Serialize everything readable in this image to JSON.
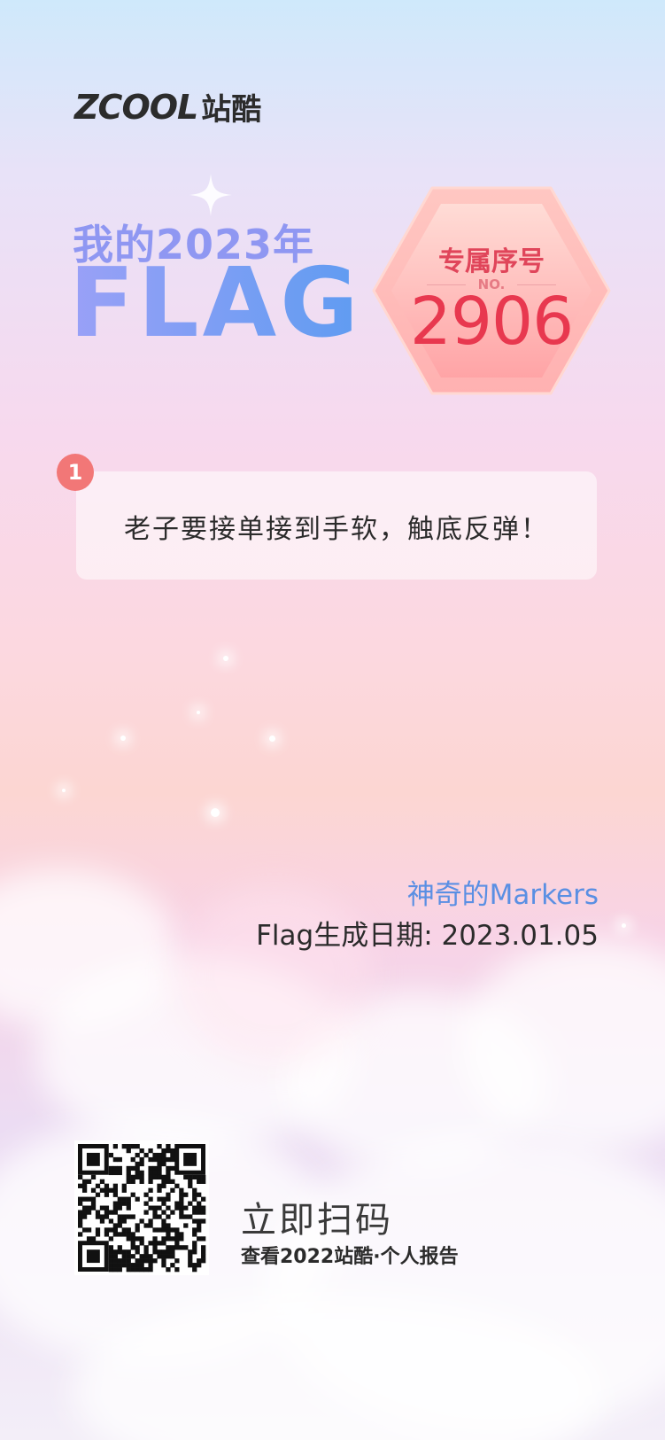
{
  "logo": {
    "en": "ZCOOL",
    "cn": "站酷"
  },
  "title": {
    "line1": "我的2023年",
    "line2": "FLAG"
  },
  "badge": {
    "title": "专属序号",
    "no_label": "NO.",
    "number": "2906"
  },
  "flags": [
    {
      "index": "1",
      "text": "老子要接单接到手软，触底反弹！"
    }
  ],
  "footer": {
    "author": "神奇的Markers",
    "date_line": "Flag生成日期: 2023.01.05"
  },
  "qr": {
    "title": "立即扫码",
    "subtitle": "查看2022站酷·个人报告"
  },
  "colors": {
    "accent_blue": "#5a8fe3",
    "badge_red": "#e8384f",
    "index_circle": "#f27777"
  }
}
